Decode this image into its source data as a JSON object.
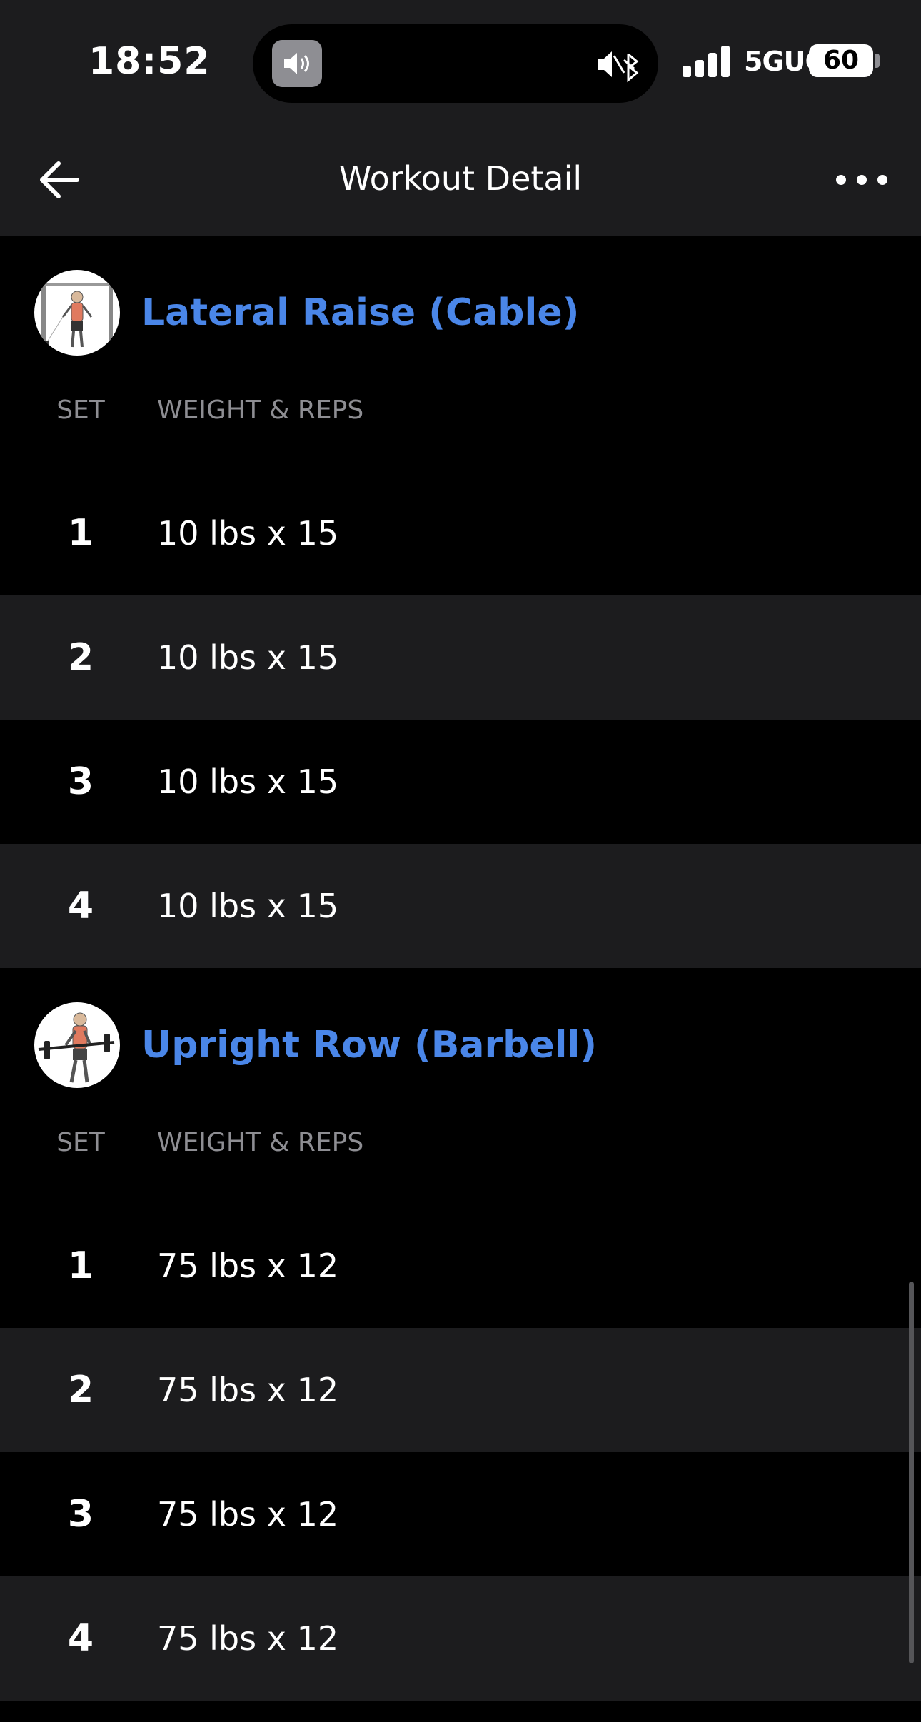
{
  "status_bar": {
    "time": "18:52",
    "network": "5GUC",
    "battery": "60"
  },
  "nav": {
    "title": "Workout Detail",
    "back_icon": "arrow-left-icon",
    "more_icon": "more-horizontal-icon"
  },
  "exercises": [
    {
      "name": "Lateral Raise (Cable)",
      "set_label": "SET",
      "weight_reps_label": "WEIGHT & REPS",
      "sets": [
        {
          "num": "1",
          "value": "10 lbs x 15"
        },
        {
          "num": "2",
          "value": "10 lbs x 15"
        },
        {
          "num": "3",
          "value": "10 lbs x 15"
        },
        {
          "num": "4",
          "value": "10 lbs x 15"
        }
      ]
    },
    {
      "name": "Upright Row (Barbell)",
      "set_label": "SET",
      "weight_reps_label": "WEIGHT & REPS",
      "sets": [
        {
          "num": "1",
          "value": "75 lbs x 12"
        },
        {
          "num": "2",
          "value": "75 lbs x 12"
        },
        {
          "num": "3",
          "value": "75 lbs x 12"
        },
        {
          "num": "4",
          "value": "75 lbs x 12"
        }
      ]
    }
  ],
  "colors": {
    "accent": "#4a86e8",
    "background": "#000000",
    "alt_row": "#1c1c1e",
    "muted": "#8e8e93"
  }
}
